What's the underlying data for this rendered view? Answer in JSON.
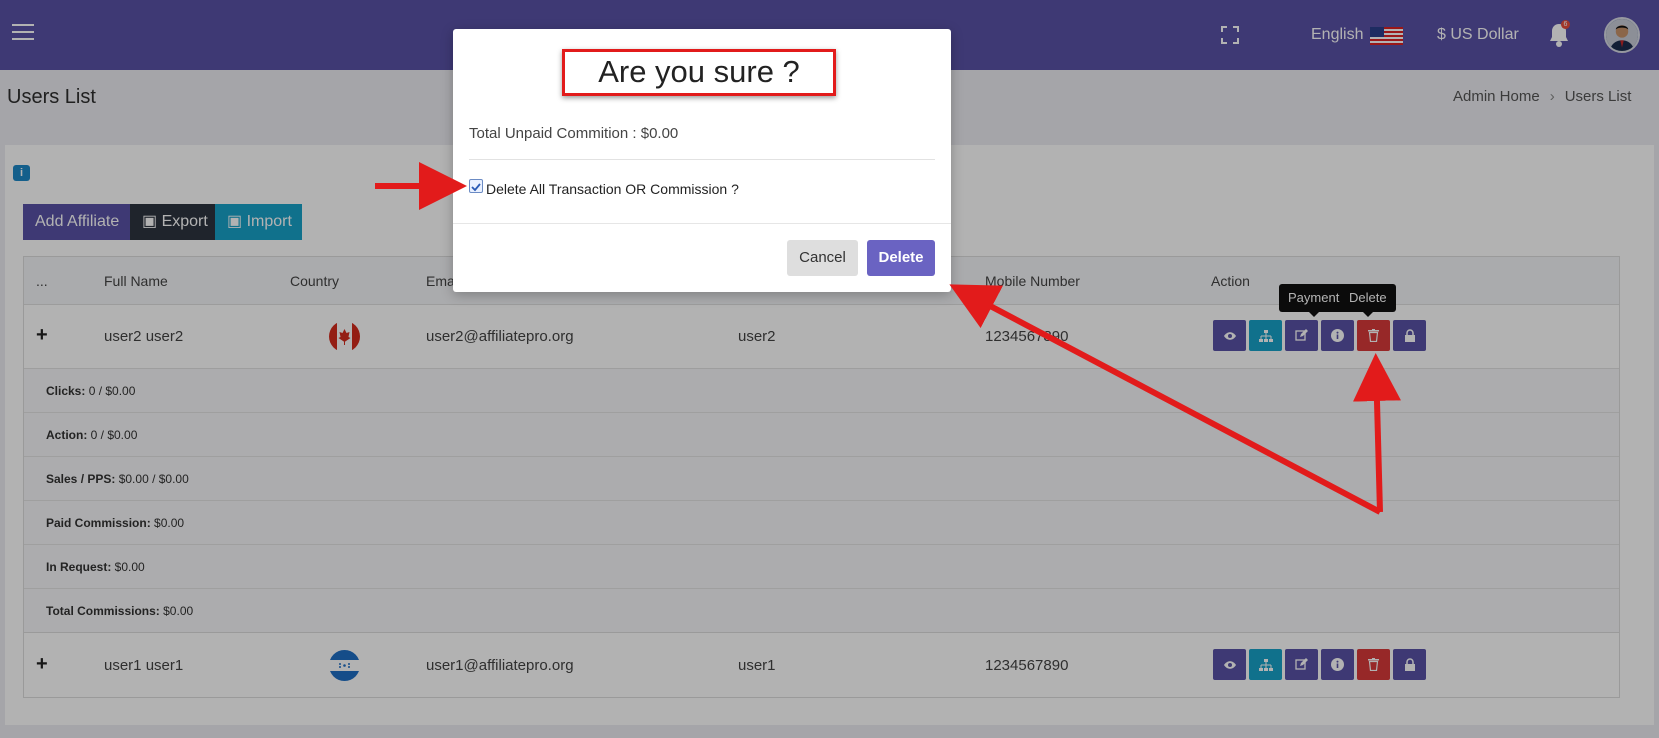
{
  "header": {
    "language": "English",
    "currency": "$ US Dollar",
    "notification_count": "6"
  },
  "page": {
    "title": "Users List",
    "breadcrumb": [
      "Admin Home",
      "Users List"
    ]
  },
  "toolbar": {
    "add_label": "Add Affiliate",
    "export_label": "Export",
    "import_label": "Import",
    "info_icon": "i"
  },
  "table": {
    "columns": [
      "...",
      "Full Name",
      "Country",
      "Ema",
      "Mobile Number",
      "Action"
    ],
    "rows": [
      {
        "name": "user2 user2",
        "email": "user2@affiliatepro.org",
        "username": "user2",
        "mobile": "1234567890",
        "country_flag": "canada-flag-icon"
      },
      {
        "name": "user1 user1",
        "email": "user1@affiliatepro.org",
        "username": "user1",
        "mobile": "1234567890",
        "country_flag": "honduras-flag-icon"
      }
    ],
    "details": [
      {
        "label": "Clicks:",
        "value": " 0 / $0.00"
      },
      {
        "label": "Action:",
        "value": " 0 / $0.00"
      },
      {
        "label": "Sales / PPS:",
        "value": " $0.00 / $0.00"
      },
      {
        "label": "Paid Commission:",
        "value": " $0.00"
      },
      {
        "label": "In Request:",
        "value": " $0.00"
      },
      {
        "label": "Total Commissions:",
        "value": " $0.00"
      }
    ],
    "action_icons": [
      "eye-icon",
      "sitemap-icon",
      "edit-icon",
      "info-icon",
      "trash-icon",
      "lock-icon"
    ]
  },
  "tooltips": {
    "payment": "Payment",
    "delete": "Delete"
  },
  "modal": {
    "title": "Are you sure ?",
    "text": "Total Unpaid Commition : $0.00",
    "checkbox_label": "Delete All Transaction OR Commission ?",
    "checkbox_checked": true,
    "cancel_label": "Cancel",
    "delete_label": "Delete"
  },
  "colors": {
    "primary": "#5a52a6",
    "info": "#17a2c9",
    "danger": "#d83a3a",
    "annotation": "#e21b1b"
  }
}
